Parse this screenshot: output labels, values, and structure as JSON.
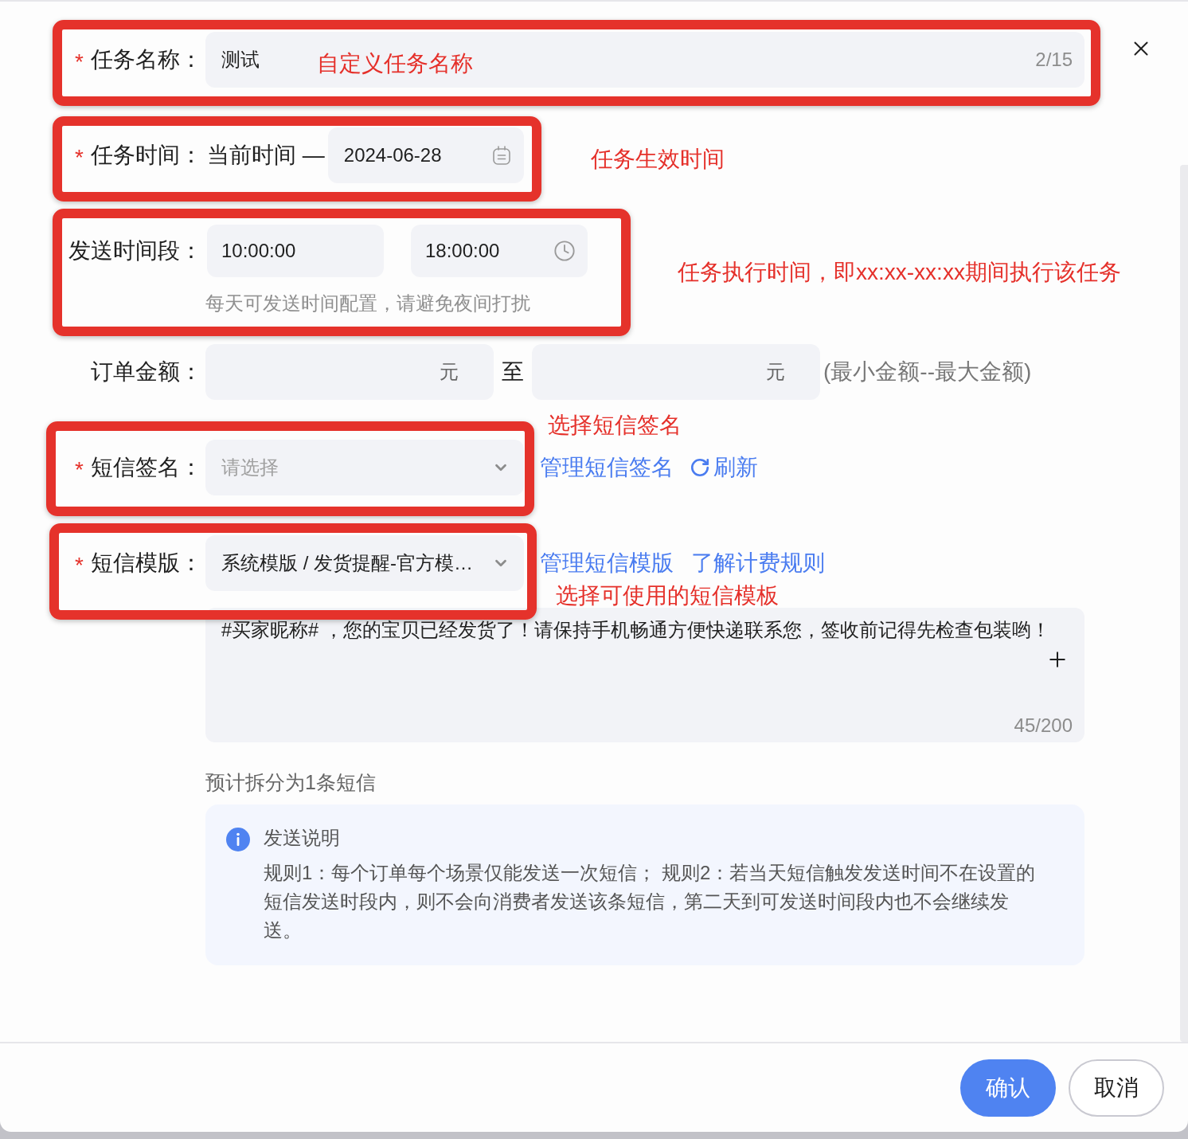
{
  "task_name": {
    "required_mark": "*",
    "label": "任务名称：",
    "value": "测试",
    "counter": "2/15",
    "annotation": "自定义任务名称"
  },
  "task_time": {
    "required_mark": "*",
    "label": "任务时间：",
    "start_text": "当前时间 —",
    "date_value": "2024-06-28",
    "annotation": "任务生效时间"
  },
  "send_period": {
    "label": "发送时间段：",
    "start_value": "10:00:00",
    "end_value": "18:00:00",
    "hint": "每天可发送时间配置，请避免夜间打扰",
    "annotation": "任务执行时间，即xx:xx-xx:xx期间执行该任务"
  },
  "order_amount": {
    "label": "订单金额：",
    "min_unit": "元",
    "separator": "至",
    "max_unit": "元",
    "note": "(最小金额--最大金额)"
  },
  "sms_signature": {
    "required_mark": "*",
    "label": "短信签名：",
    "placeholder": "请选择",
    "links": [
      "管理短信签名"
    ],
    "refresh_link": "刷新",
    "annotation": "选择短信签名"
  },
  "sms_template": {
    "required_mark": "*",
    "label": "短信模版：",
    "value": "系统模版 / 发货提醒-官方模…",
    "links": [
      "管理短信模版",
      "了解计费规则"
    ],
    "annotation": "选择可使用的短信模板"
  },
  "sms_content": {
    "value": "#买家昵称# ，您的宝贝已经发货了！请保持手机畅通方便快递联系您，签收前记得先检查包装哟！",
    "counter": "45/200"
  },
  "split_estimate": "预计拆分为1条短信",
  "notice": {
    "title": "发送说明",
    "body": "规则1：每个订单每个场景仅能发送一次短信； 规则2：若当天短信触发发送时间不在设置的短信发送时段内，则不会向消费者发送该条短信，第二天到可发送时间段内也不会继续发送。"
  },
  "buttons": [
    {
      "label": "确认",
      "kind": "primary"
    },
    {
      "label": "取消",
      "kind": "secondary"
    }
  ]
}
